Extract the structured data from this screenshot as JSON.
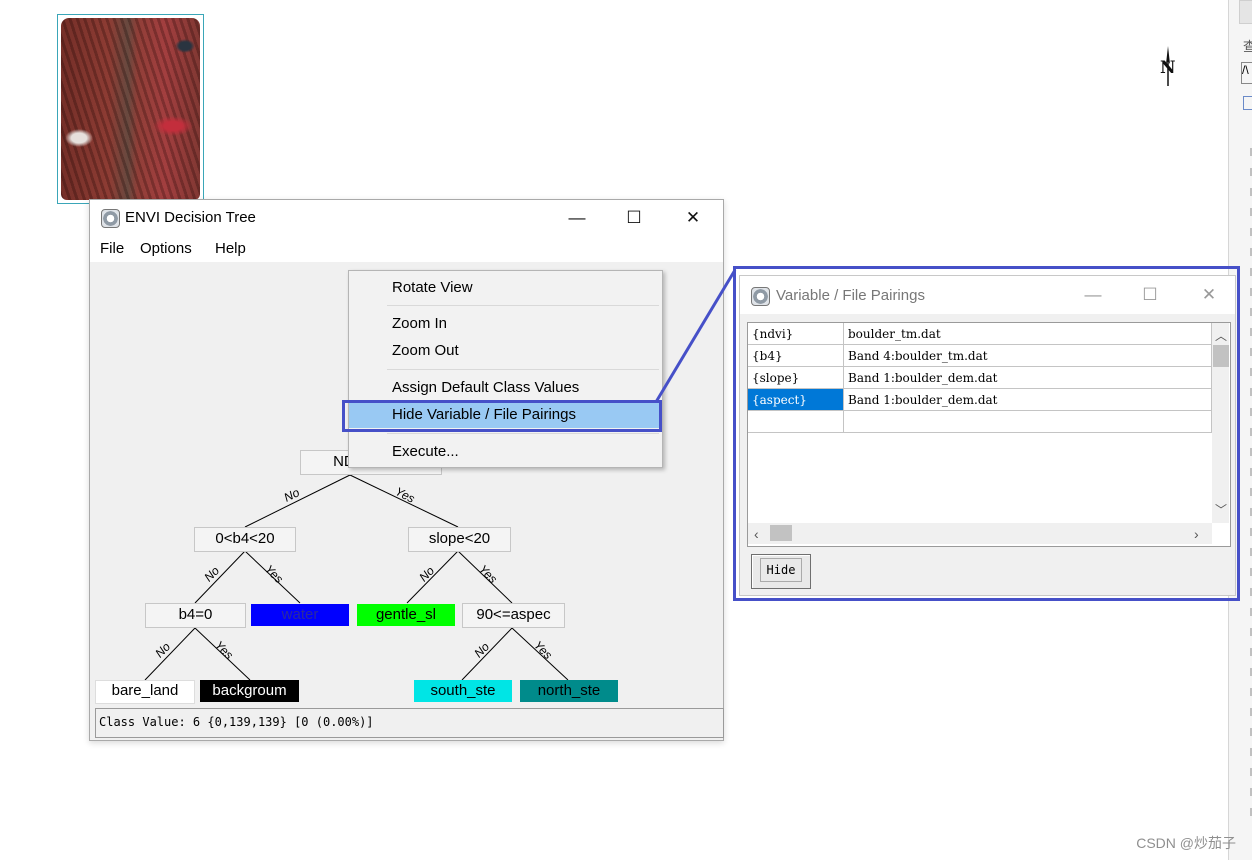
{
  "envi_window": {
    "title": "ENVI Decision Tree",
    "menu": [
      "File",
      "Options",
      "Help"
    ],
    "status": "Class Value: 6 {0,139,139} [0 (0.00%)]"
  },
  "window_controls": {
    "minimize": "—",
    "maximize": "☐",
    "close": "✕"
  },
  "context_menu": {
    "items": [
      "Rotate View",
      "Zoom In",
      "Zoom Out",
      "Assign Default Class Values",
      "Hide Variable / File Pairings",
      "Execute..."
    ],
    "highlighted": "Hide Variable / File Pairings"
  },
  "tree": {
    "nodes": {
      "root": "NDVI",
      "b4_range": "0<b4<20",
      "slope": "slope<20",
      "b4_zero": "b4=0",
      "aspect": "90<=aspec"
    },
    "leaves": [
      {
        "label": "water",
        "color": "#0000ff",
        "text_color": "#2a2aa0"
      },
      {
        "label": "gentle_sl",
        "color": "#00ff00",
        "text_color": "#000000"
      },
      {
        "label": "bare_land",
        "color": "#ffffff",
        "text_color": "#000000"
      },
      {
        "label": "backgroum",
        "color": "#000000",
        "text_color": "#ffffff"
      },
      {
        "label": "south_ste",
        "color": "#00e5e5",
        "text_color": "#000000"
      },
      {
        "label": "north_ste",
        "color": "#008b8b",
        "text_color": "#000000"
      }
    ],
    "edge_labels": {
      "no": "No",
      "yes": "Yes"
    }
  },
  "pairings_window": {
    "title": "Variable / File Pairings",
    "rows": [
      {
        "variable": "{ndvi}",
        "file": "boulder_tm.dat"
      },
      {
        "variable": "{b4}",
        "file": "Band 4:boulder_tm.dat"
      },
      {
        "variable": "{slope}",
        "file": "Band 1:boulder_dem.dat"
      },
      {
        "variable": "{aspect}",
        "file": "Band 1:boulder_dem.dat"
      },
      {
        "variable": "",
        "file": ""
      }
    ],
    "selected_row": 3,
    "hide_button": "Hide"
  },
  "side_panel": {
    "glyph_1": "查",
    "glyph_2": "/\\"
  },
  "north_arrow": "N",
  "watermark": "CSDN @炒茄子",
  "colors": {
    "highlight_outline": "#4650c8",
    "menu_highlight": "#99c9f3",
    "selection": "#0078d7"
  }
}
